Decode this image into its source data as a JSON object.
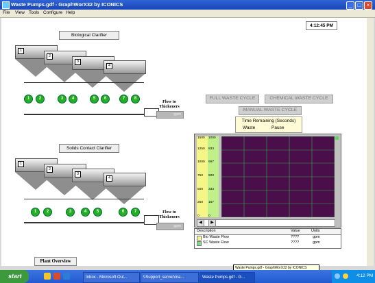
{
  "window": {
    "title": "Waste Pumps.gdf - GraphWorX32 by ICONICS",
    "menu": [
      "File",
      "View",
      "Tools",
      "Configure",
      "Help"
    ]
  },
  "clock": "4:12:45 PM",
  "bio_clarifier": {
    "title": "Biological Clarifier",
    "tanks": [
      "1",
      "2",
      "3",
      "4"
    ],
    "pumps": [
      "1",
      "2",
      "3",
      "4",
      "5",
      "6",
      "7",
      "8"
    ],
    "flow_label": "Flow to Thickeners",
    "flow_unit": "gpm"
  },
  "sc_clarifier": {
    "title": "Solids Contact Clarifier",
    "tanks": [
      "1",
      "2",
      "3",
      "4"
    ],
    "pumps": [
      "1",
      "2",
      "3",
      "4",
      "5",
      "6",
      "7"
    ],
    "flow_label": "Flow to Thickeners",
    "flow_unit": "gpm"
  },
  "cycle_buttons": {
    "full": "FULL WASTE CYCLE",
    "chemical": "CHEMICAL WASTE CYCLE",
    "manual": "MANUAL WASTE CYCLE"
  },
  "time_remaining": {
    "title": "Time Remaining (Seconds)",
    "waste_label": "Waste",
    "pause_label": "Pause"
  },
  "chart_data": {
    "type": "line",
    "axes": [
      {
        "ticks": [
          "1500",
          "1250",
          "1000",
          "750",
          "500",
          "250",
          "0"
        ],
        "color": "#f5f588"
      },
      {
        "ticks": [
          "1000",
          "833",
          "667",
          "500",
          "333",
          "167",
          "0"
        ],
        "color": "#bff08a"
      }
    ],
    "series": [
      {
        "name": "Bio Waste Flow",
        "values": [],
        "color": "#f5f588"
      },
      {
        "name": "SC Waste Flow",
        "values": [],
        "color": "#7fe07f"
      }
    ],
    "grid": true
  },
  "legend_table": {
    "headers": [
      "Description",
      "Value",
      "Units"
    ],
    "rows": [
      {
        "description": "Bio Waste Flow",
        "value": "????",
        "units": "gpm"
      },
      {
        "description": "SC Waste Flow",
        "value": "????",
        "units": "gpm"
      }
    ]
  },
  "plant_overview_button": "Plant Overview",
  "tooltip": "Waste Pumps.gdf - GraphWorX32 by ICONICS",
  "taskbar": {
    "start": "start",
    "tasks": [
      "Inbox - Microsoft Out...",
      "\\\\Support_server\\ma...",
      "Waste Pumps.gdf - G..."
    ],
    "clock": "4:12 PM"
  }
}
